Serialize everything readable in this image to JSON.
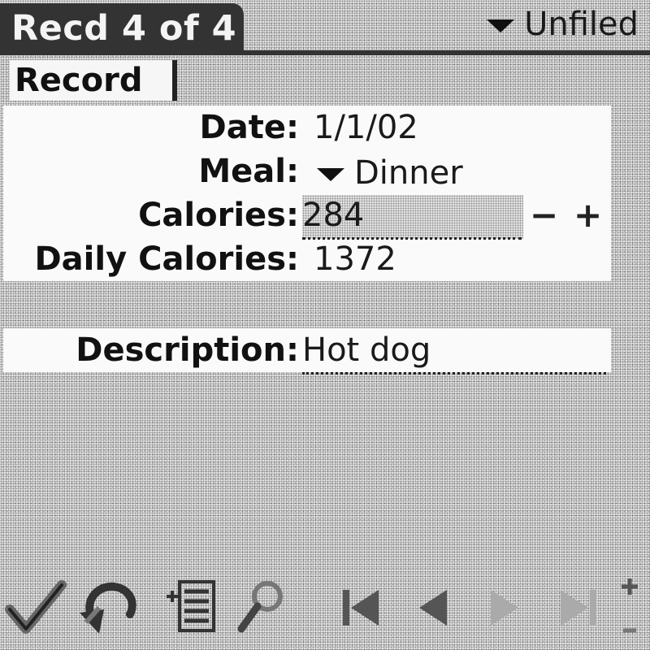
{
  "header": {
    "title": "Recd 4 of 4",
    "category": "Unfiled"
  },
  "section": {
    "label": "Record"
  },
  "form": {
    "date_label": "Date:",
    "date_value": "1/1/02",
    "meal_label": "Meal:",
    "meal_value": "Dinner",
    "calories_label": "Calories:",
    "calories_value": "284",
    "decrement": "−",
    "increment": "+",
    "daily_label": "Daily Calories:",
    "daily_value": "1372",
    "description_label": "Description:",
    "description_value": "Hot dog"
  },
  "toolbar": {
    "icons": [
      "checkmark-icon",
      "undo-icon",
      "list-icon",
      "find-icon",
      "first-record-icon",
      "previous-record-icon",
      "next-record-icon",
      "last-record-icon",
      "scroll-icon"
    ]
  },
  "colors": {
    "title_bar": "#333333",
    "background": "#e4e4e4",
    "panel": "#fafafa",
    "text": "#111111"
  }
}
